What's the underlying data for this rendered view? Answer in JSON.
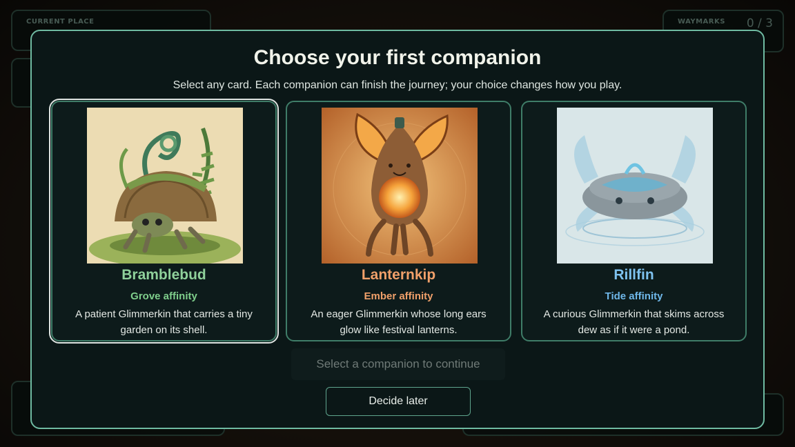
{
  "hud": {
    "place_label": "CURRENT PLACE",
    "waymarks_label": "WAYMARKS",
    "waymarks_value": "0 / 3"
  },
  "modal": {
    "title": "Choose your first companion",
    "subtitle": "Select any card. Each companion can finish the journey; your choice changes how you play.",
    "continue_label": "Select a companion to continue",
    "later_label": "Decide later"
  },
  "cards": [
    {
      "name": "Bramblebud",
      "affinity": "Grove affinity",
      "description": "A patient Glimmerkin that carries a tiny garden on its shell.",
      "color": "#8fd19b",
      "selected": true
    },
    {
      "name": "Lanternkip",
      "affinity": "Ember affinity",
      "description": "An eager Glimmerkin whose long ears glow like festival lanterns.",
      "color": "#f0a06a",
      "selected": false
    },
    {
      "name": "Rillfin",
      "affinity": "Tide affinity",
      "description": "A curious Glimmerkin that skims across dew as if it were a pond.",
      "color": "#7ec2ef",
      "selected": false
    }
  ]
}
